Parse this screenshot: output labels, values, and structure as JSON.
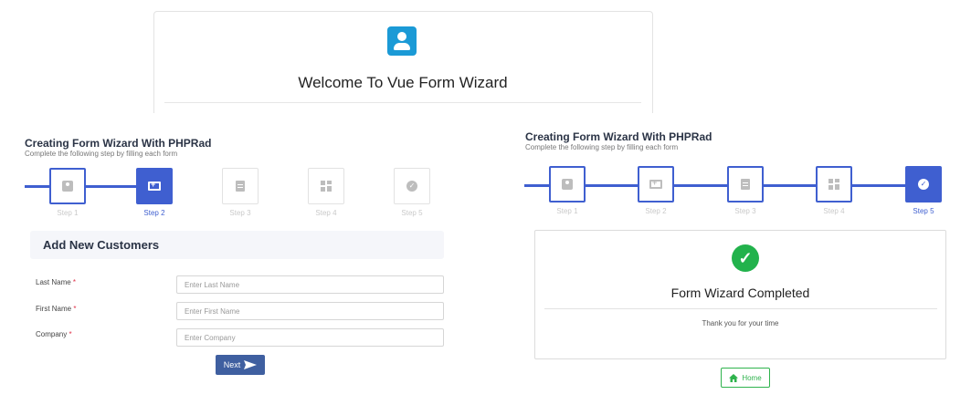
{
  "welcome": {
    "title": "Welcome To Vue Form Wizard"
  },
  "left": {
    "title": "Creating Form Wizard With PHPRad",
    "subtitle": "Complete the following step by filling each form",
    "steps": [
      "Step 1",
      "Step 2",
      "Step 3",
      "Step 4",
      "Step 5"
    ],
    "section": "Add New Customers",
    "fields": [
      {
        "label": "Last Name",
        "required": "*",
        "placeholder": "Enter Last Name"
      },
      {
        "label": "First Name",
        "required": "*",
        "placeholder": "Enter First Name"
      },
      {
        "label": "Company",
        "required": "*",
        "placeholder": "Enter Company"
      }
    ],
    "next_label": "Next"
  },
  "right": {
    "title": "Creating Form Wizard With PHPRad",
    "subtitle": "Complete the following step by filling each form",
    "steps": [
      "Step 1",
      "Step 2",
      "Step 3",
      "Step 4",
      "Step 5"
    ],
    "completed_title": "Form Wizard Completed",
    "completed_sub": "Thank you for your time",
    "home_label": "Home"
  },
  "colors": {
    "accent": "#3f5fd0",
    "success": "#22b24c",
    "required": "#e0334a",
    "welcome_icon": "#1b9ad6"
  }
}
